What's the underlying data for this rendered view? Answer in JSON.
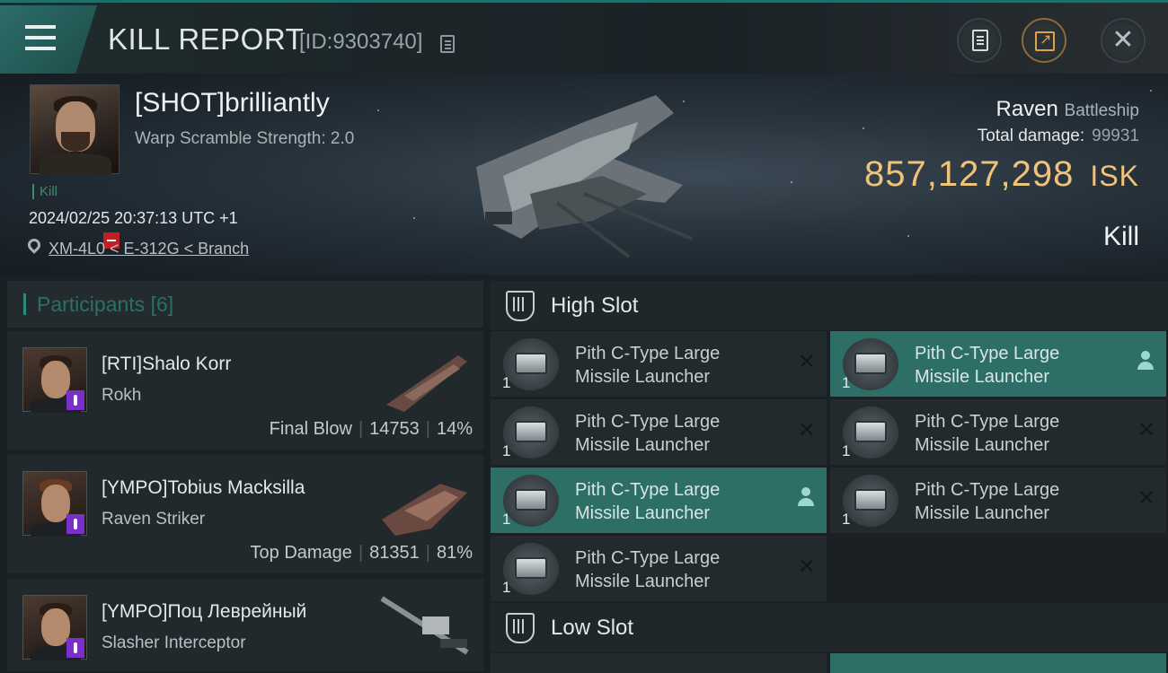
{
  "header": {
    "title": "KILL REPORT",
    "id_label": "[ID:9303740]"
  },
  "victim": {
    "name": "[SHOT]brilliantly",
    "subtitle": "Warp Scramble Strength: 2.0",
    "tag": "Kill",
    "timestamp": "2024/02/25 20:37:13 UTC +1",
    "location": "XM-4L0 < E-312G < Branch",
    "ship_name": "Raven",
    "ship_class": "Battleship",
    "total_damage_label": "Total damage:",
    "total_damage": "99931",
    "isk_value": "857,127,298",
    "isk_unit": "ISK",
    "result": "Kill",
    "security_badge_color": "#c01f24"
  },
  "participants": {
    "label": "Participants",
    "count": "[6]",
    "items": [
      {
        "name": "[RTI]Shalo Korr",
        "ship": "Rokh",
        "role": "Final Blow",
        "damage": "14753",
        "percent": "14%"
      },
      {
        "name": "[YMPO]Tobius Macksilla",
        "ship": "Raven Striker",
        "role": "Top Damage",
        "damage": "81351",
        "percent": "81%"
      },
      {
        "name": "[YMPO]Поц Леврейный",
        "ship": "Slasher Interceptor",
        "role": "",
        "damage": "",
        "percent": ""
      }
    ]
  },
  "high_slot": {
    "title": "High Slot",
    "items": [
      {
        "qty": "1",
        "line1": "Pith C-Type Large",
        "line2": "Missile Launcher",
        "status": "destroyed"
      },
      {
        "qty": "1",
        "line1": "Pith C-Type Large",
        "line2": "Missile Launcher",
        "status": "dropped"
      },
      {
        "qty": "1",
        "line1": "Pith C-Type Large",
        "line2": "Missile Launcher",
        "status": "destroyed"
      },
      {
        "qty": "1",
        "line1": "Pith C-Type Large",
        "line2": "Missile Launcher",
        "status": "destroyed"
      },
      {
        "qty": "1",
        "line1": "Pith C-Type Large",
        "line2": "Missile Launcher",
        "status": "dropped"
      },
      {
        "qty": "1",
        "line1": "Pith C-Type Large",
        "line2": "Missile Launcher",
        "status": "destroyed"
      },
      {
        "qty": "1",
        "line1": "Pith C-Type Large",
        "line2": "Missile Launcher",
        "status": "destroyed"
      }
    ]
  },
  "low_slot": {
    "title": "Low Slot"
  },
  "colors": {
    "accent": "#2d6e66",
    "isk": "#f1c27a",
    "security_purple": "#7b2fc9"
  }
}
